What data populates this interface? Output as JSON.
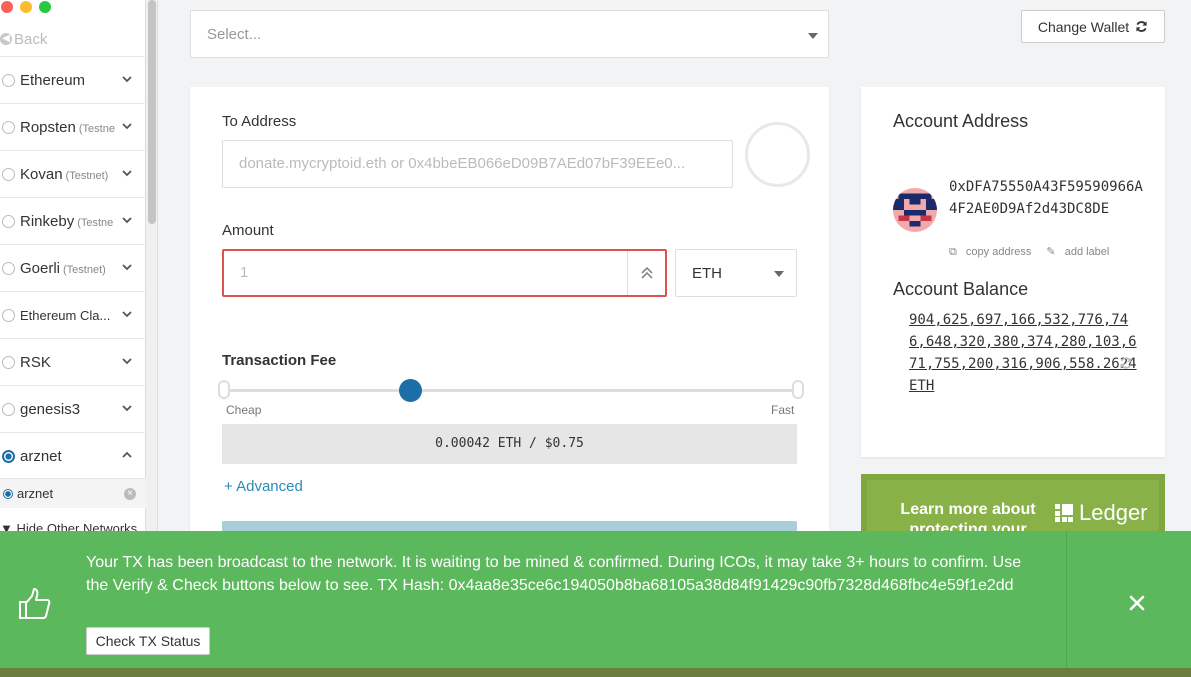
{
  "window": {
    "back_label": "Back"
  },
  "sidebar": {
    "networks": [
      {
        "name": "Ethereum",
        "testnet": "",
        "expanded": false
      },
      {
        "name": "Ropsten",
        "testnet": "(Testne",
        "expanded": false
      },
      {
        "name": "Kovan",
        "testnet": "(Testnet)",
        "expanded": false
      },
      {
        "name": "Rinkeby",
        "testnet": "(Testne",
        "expanded": false
      },
      {
        "name": "Goerli",
        "testnet": "(Testnet)",
        "expanded": false
      },
      {
        "name": "Ethereum Cla...",
        "testnet": "",
        "expanded": false
      },
      {
        "name": "RSK",
        "testnet": "",
        "expanded": false
      },
      {
        "name": "genesis3",
        "testnet": "",
        "expanded": false
      },
      {
        "name": "arznet",
        "testnet": "",
        "expanded": true
      }
    ],
    "sub_node": "arznet",
    "hide_other": "Hide Other Networks"
  },
  "header": {
    "select_placeholder": "Select...",
    "change_wallet": "Change Wallet"
  },
  "send": {
    "to_address_label": "To Address",
    "to_address_placeholder": "donate.mycryptoid.eth or 0x4bbeEB066eD09B7AEd07bF39EEe0...",
    "amount_label": "Amount",
    "amount_value": "1",
    "unit": "ETH",
    "fee_label": "Transaction Fee",
    "slider_min_label": "Cheap",
    "slider_max_label": "Fast",
    "slider_level": 0.32,
    "fee_value": "0.00042 ETH / $0.75",
    "advanced": "+ Advanced"
  },
  "account": {
    "address_title": "Account Address",
    "address": "0xDFA75550A43F59590966A4F2AE0D9Af2d43DC8DE",
    "copy_address": "copy address",
    "add_label": "add label",
    "balance_title": "Account Balance",
    "balance": "904,625,697,166,532,776,746,648,320,380,374,280,103,671,755,200,316,906,558.2624 ETH"
  },
  "promo": {
    "text": "Learn more about protecting your",
    "brand": "Ledger"
  },
  "notice": {
    "message": "Your TX has been broadcast to the network. It is waiting to be mined & confirmed. During ICOs, it may take 3+ hours to confirm. Use the Verify & Check buttons below to see. TX Hash: 0x4aa8e35ce6c194050b8ba68105a38d84f91429c90fb7328d468fbc4e59f1e2dd",
    "check_button": "Check TX Status"
  },
  "colors": {
    "accent": "#1d6ea6",
    "success": "#5cb85c",
    "error": "#d9534f",
    "link": "#2a8bb5"
  }
}
